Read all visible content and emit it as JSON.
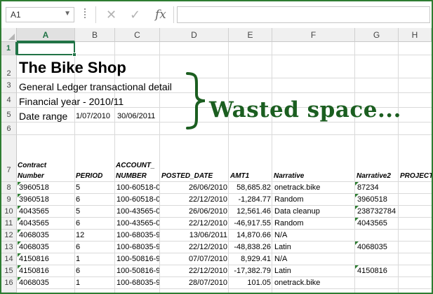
{
  "formula_bar": {
    "name_box": "A1",
    "formula": "",
    "fx_label": "fx"
  },
  "columns": [
    "A",
    "B",
    "C",
    "D",
    "E",
    "F",
    "G",
    "H"
  ],
  "rows": [
    "1",
    "2",
    "3",
    "4",
    "5",
    "6",
    "7",
    "8",
    "9",
    "10",
    "11",
    "12",
    "13",
    "14",
    "15",
    "16"
  ],
  "header_block": {
    "title": "The Bike Shop",
    "subtitle": "General Ledger transactional detail",
    "fin_year": "Financial year - 2010/11",
    "date_range_label": "Date range",
    "date_from": "1/07/2010",
    "date_to": "30/06/2011"
  },
  "annotation": "Wasted space...",
  "table_headers": {
    "contract_number": "Contract Number",
    "period": "PERIOD",
    "account_number": "ACCOUNT_ NUMBER",
    "posted_date": "POSTED_DATE",
    "amt1": "AMT1",
    "narrative": "Narrative",
    "narrative2": "Narrative2",
    "project": "PROJECT"
  },
  "table_rows": [
    {
      "contract": "3960518",
      "period": "5",
      "account": "100-60518-0",
      "posted": "26/06/2010",
      "amt": "58,685.82",
      "narrative": "onetrack.bike",
      "narrative2": "87234"
    },
    {
      "contract": "3960518",
      "period": "6",
      "account": "100-60518-0",
      "posted": "22/12/2010",
      "amt": "-1,284.77",
      "narrative": "Random",
      "narrative2": "3960518"
    },
    {
      "contract": "4043565",
      "period": "5",
      "account": "100-43565-0",
      "posted": "26/06/2010",
      "amt": "12,561.46",
      "narrative": "Data cleanup",
      "narrative2": "238732784"
    },
    {
      "contract": "4043565",
      "period": "6",
      "account": "100-43565-0",
      "posted": "22/12/2010",
      "amt": "-46,917.55",
      "narrative": "Random",
      "narrative2": "4043565"
    },
    {
      "contract": "4068035",
      "period": "12",
      "account": "100-68035-9",
      "posted": "13/06/2011",
      "amt": "14,870.66",
      "narrative": "N/A",
      "narrative2": ""
    },
    {
      "contract": "4068035",
      "period": "6",
      "account": "100-68035-9",
      "posted": "22/12/2010",
      "amt": "-48,838.26",
      "narrative": "Latin",
      "narrative2": "4068035"
    },
    {
      "contract": "4150816",
      "period": "1",
      "account": "100-50816-9",
      "posted": "07/07/2010",
      "amt": "8,929.41",
      "narrative": "N/A",
      "narrative2": ""
    },
    {
      "contract": "4150816",
      "period": "6",
      "account": "100-50816-9",
      "posted": "22/12/2010",
      "amt": "-17,382.79",
      "narrative": "Latin",
      "narrative2": "4150816"
    },
    {
      "contract": "4068035",
      "period": "1",
      "account": "100-68035-9",
      "posted": "28/07/2010",
      "amt": "101.05",
      "narrative": "onetrack.bike",
      "narrative2": ""
    }
  ],
  "colors": {
    "accent": "#217346",
    "annotation": "#1b5e20",
    "frame": "#2e7d32"
  },
  "icons": [
    "cancel-icon",
    "enter-icon",
    "function-icon",
    "dropdown-icon"
  ]
}
